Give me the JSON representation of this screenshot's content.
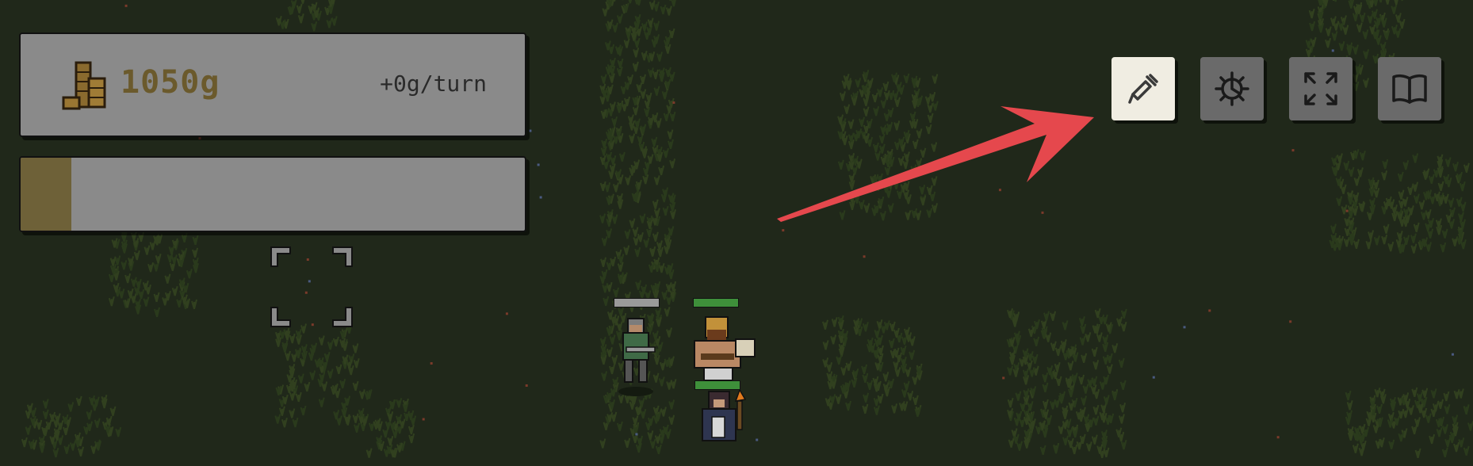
{
  "hud": {
    "gold_amount": "1050g",
    "gold_rate": "+0g/turn",
    "turn_progress": 0.1
  },
  "toolbar": {
    "buttons": [
      {
        "name": "editor-tool-button",
        "icon": "dropper-icon",
        "active": true
      },
      {
        "name": "settings-button",
        "icon": "gear-icon",
        "active": false
      },
      {
        "name": "fullscreen-button",
        "icon": "expand-icon",
        "active": false
      },
      {
        "name": "codex-button",
        "icon": "book-icon",
        "active": false
      }
    ]
  },
  "units": [
    {
      "name": "soldier-unit",
      "health": 1.0,
      "health_color": "#9a9a9a"
    },
    {
      "name": "barbarian-unit",
      "health": 0.85,
      "health_color": "#3e8f3a"
    },
    {
      "name": "torchbearer-unit",
      "health": 1.0,
      "health_color": "#3e8f3a"
    }
  ],
  "colors": {
    "gold_text": "#6b5a2c",
    "annotation_arrow": "#e5484d",
    "active_button": "#f0ede2"
  }
}
